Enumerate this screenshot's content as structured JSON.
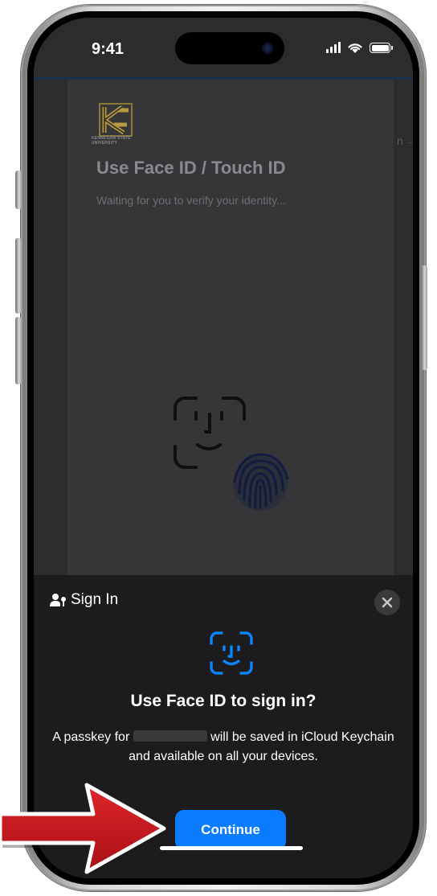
{
  "status_bar": {
    "time": "9:41"
  },
  "background_page": {
    "logo_caption": "KENNESAW STATE UNIVERSITY",
    "title": "Use Face ID / Touch ID",
    "subtitle": "Waiting for you to verify your identity...",
    "right_edge_text": "n →"
  },
  "passkey_sheet": {
    "header_label": "Sign In",
    "title": "Use Face ID to sign in?",
    "body_before": "A passkey for ",
    "body_after": " will be saved in iCloud Keychain and available on all your devices.",
    "continue_label": "Continue",
    "accent_color": "#0a7cff"
  },
  "annotation": {
    "arrow_color": "#c0171c"
  }
}
